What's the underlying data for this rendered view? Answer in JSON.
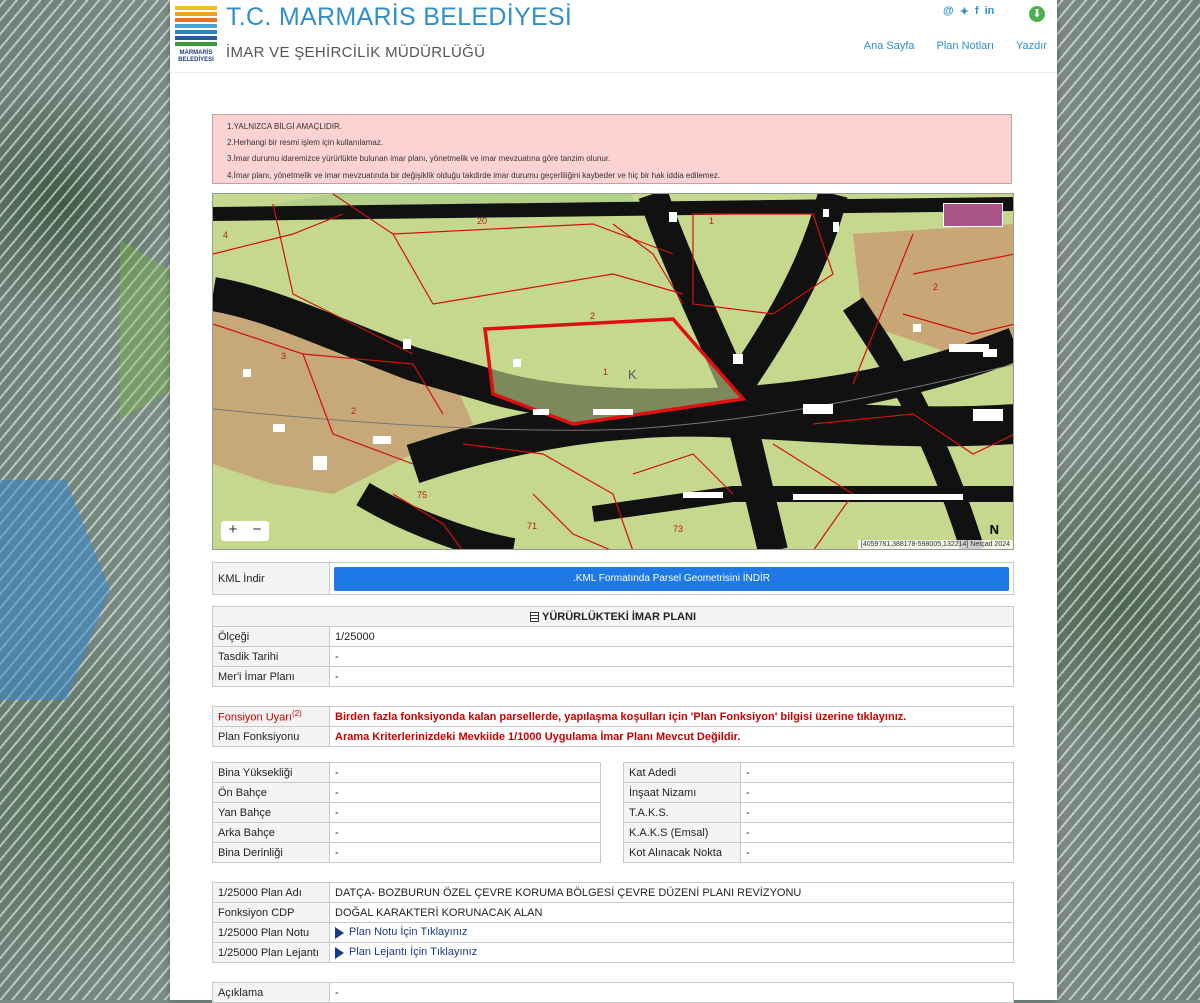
{
  "header": {
    "org_title": "T.C. MARMARİS BELEDİYESİ",
    "dept_title": "İMAR VE ŞEHİRCİLİK MÜDÜRLÜĞÜ",
    "logo_text": "MARMARİS BELEDİYESİ",
    "nav": [
      "Ana Sayfa",
      "Plan Notları",
      "Yazdır"
    ],
    "social": [
      "@",
      "twitter-icon",
      "facebook-icon",
      "linkedin-icon"
    ]
  },
  "disclaimer": [
    "1.YALNIZCA BİLGİ AMAÇLIDIR.",
    "2.Herhangi bir resmi işlem için kullanılamaz.",
    "3.İmar durumu idaremizce yürürlükte bulunan imar planı, yönetmelik ve imar mevzuatına göre tanzim olunur.",
    "4.İmar planı, yönetmelik ve imar mevzuatında bir değişiklik olduğu takdirde imar durumu geçerliliğini kaybeder ve hiç bir hak iddia edilemez."
  ],
  "map": {
    "zoom_in": "+",
    "zoom_out": "−",
    "north": "N",
    "coords": "[4059781,388178-598005,132214] Netcad 2024",
    "parcel_labels": [
      "20",
      "1",
      "4",
      "2",
      "3",
      "2",
      "1",
      "2",
      "75",
      "71",
      "73",
      "K"
    ]
  },
  "kml": {
    "label": "KML İndir",
    "button": ".KML Formatında Parsel Geometrisini İNDİR"
  },
  "imar_plani": {
    "title": "YÜRÜRLÜKTEKİ İMAR PLANI",
    "rows": [
      {
        "label": "Ölçeği",
        "value": "1/25000"
      },
      {
        "label": "Tasdik Tarihi",
        "value": "-"
      },
      {
        "label": "Mer'i İmar Planı",
        "value": "-"
      }
    ]
  },
  "fonksiyon": {
    "warning_label": "Fonsiyon Uyarı",
    "warning_sup": "(2)",
    "warning_text": "Birden fazla fonksiyonda kalan parsellerde, yapılaşma koşulları için 'Plan Fonksiyon' bilgisi üzerine tıklayınız.",
    "plan_label": "Plan Fonksiyonu",
    "plan_text": "Arama Kriterlerinizdeki Mevkiide 1/1000 Uygulama İmar Planı Mevcut Değildir."
  },
  "yapi_left": [
    {
      "label": "Bina Yüksekliği",
      "value": "-"
    },
    {
      "label": "Ön Bahçe",
      "value": "-"
    },
    {
      "label": "Yan Bahçe",
      "value": "-"
    },
    {
      "label": "Arka Bahçe",
      "value": "-"
    },
    {
      "label": "Bina Derinliği",
      "value": "-"
    }
  ],
  "yapi_right": [
    {
      "label": "Kat Adedi",
      "value": "-"
    },
    {
      "label": "İnşaat Nizamı",
      "value": "-"
    },
    {
      "label": "T.A.K.S.",
      "value": "-"
    },
    {
      "label": "K.A.K.S (Emsal)",
      "value": "-"
    },
    {
      "label": "Kot Alınacak Nokta",
      "value": "-"
    }
  ],
  "plan_25000": {
    "rows": [
      {
        "label": "1/25000 Plan Adı",
        "value": "DATÇA- BOZBURUN ÖZEL ÇEVRE KORUMA BÖLGESİ ÇEVRE DÜZENİ PLANI REVİZYONU"
      },
      {
        "label": "Fonksiyon CDP",
        "value": "DOĞAL KARAKTERİ KORUNACAK ALAN"
      }
    ],
    "note_label": "1/25000 Plan Notu",
    "note_link": "Plan Notu İçin Tıklayınız",
    "legend_label": "1/25000 Plan Lejantı",
    "legend_link": "Plan Lejantı İçin Tıklayınız"
  },
  "aciklama": {
    "label": "Açıklama",
    "value": "-"
  }
}
